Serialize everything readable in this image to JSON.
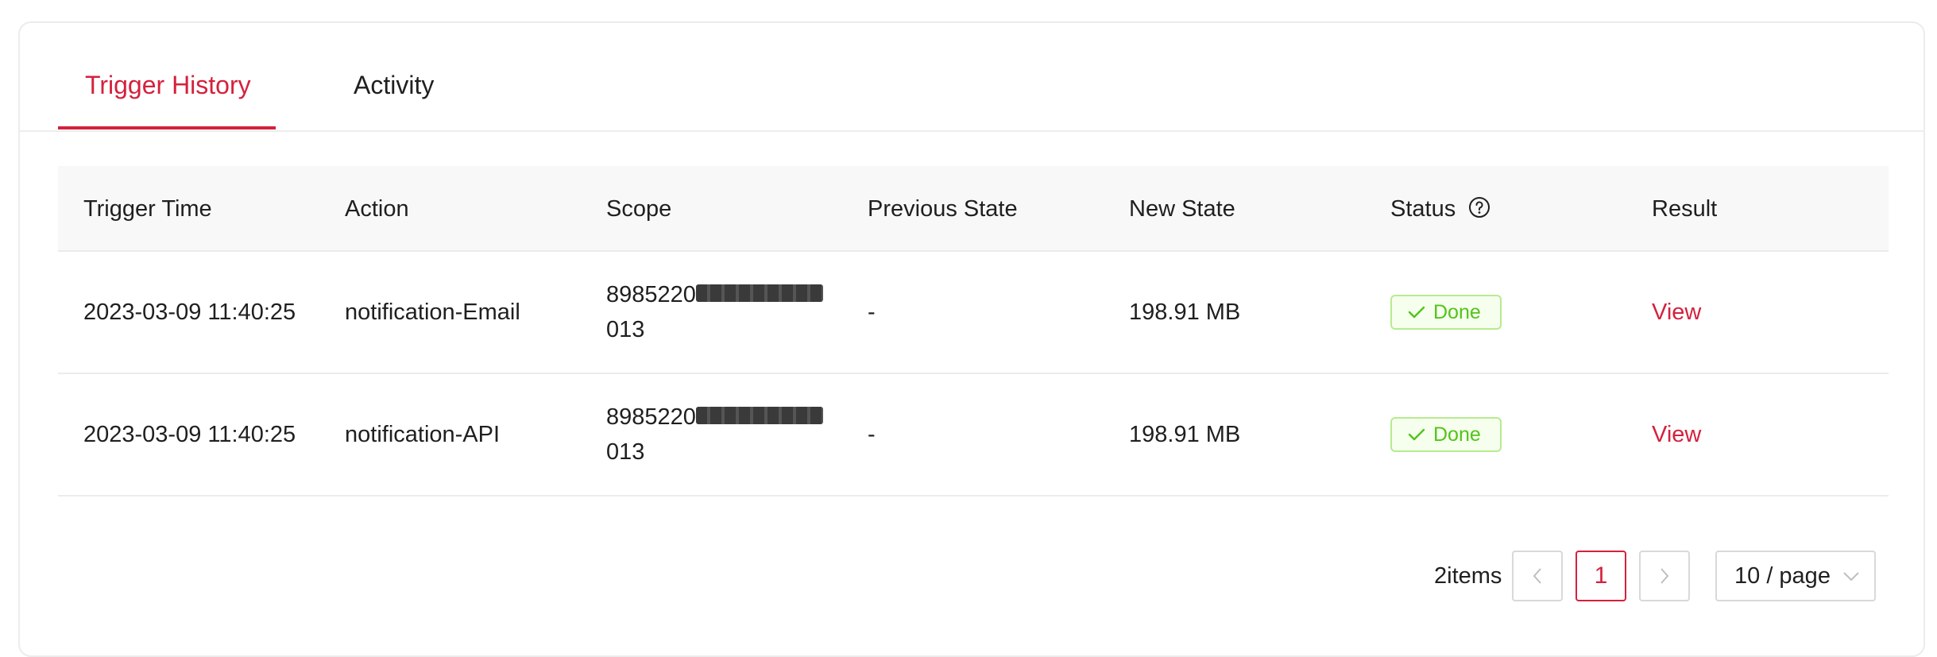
{
  "tabs": [
    {
      "label": "Trigger History",
      "active": true
    },
    {
      "label": "Activity",
      "active": false
    }
  ],
  "table": {
    "columns": [
      "Trigger Time",
      "Action",
      "Scope",
      "Previous State",
      "New State",
      "Status",
      "Result"
    ],
    "rows": [
      {
        "trigger_time": "2023-03-09 11:40:25",
        "action": "notification-Email",
        "scope_prefix": "8985220",
        "scope_suffix": "013",
        "previous_state": "-",
        "new_state": "198.91 MB",
        "status": "Done",
        "result": "View"
      },
      {
        "trigger_time": "2023-03-09 11:40:25",
        "action": "notification-API",
        "scope_prefix": "8985220",
        "scope_suffix": "013",
        "previous_state": "-",
        "new_state": "198.91 MB",
        "status": "Done",
        "result": "View"
      }
    ]
  },
  "pagination": {
    "total": "2items",
    "current_page": "1",
    "page_size": "10 / page"
  },
  "icons": {
    "status_help": "question-circle-icon",
    "done": "check-icon",
    "prev": "chevron-left-icon",
    "next": "chevron-right-icon",
    "dropdown": "chevron-down-icon"
  },
  "colors": {
    "accent": "#d4213d",
    "success": "#52c41a",
    "success_bg": "#f6ffed",
    "success_border": "#b7eb8f"
  }
}
